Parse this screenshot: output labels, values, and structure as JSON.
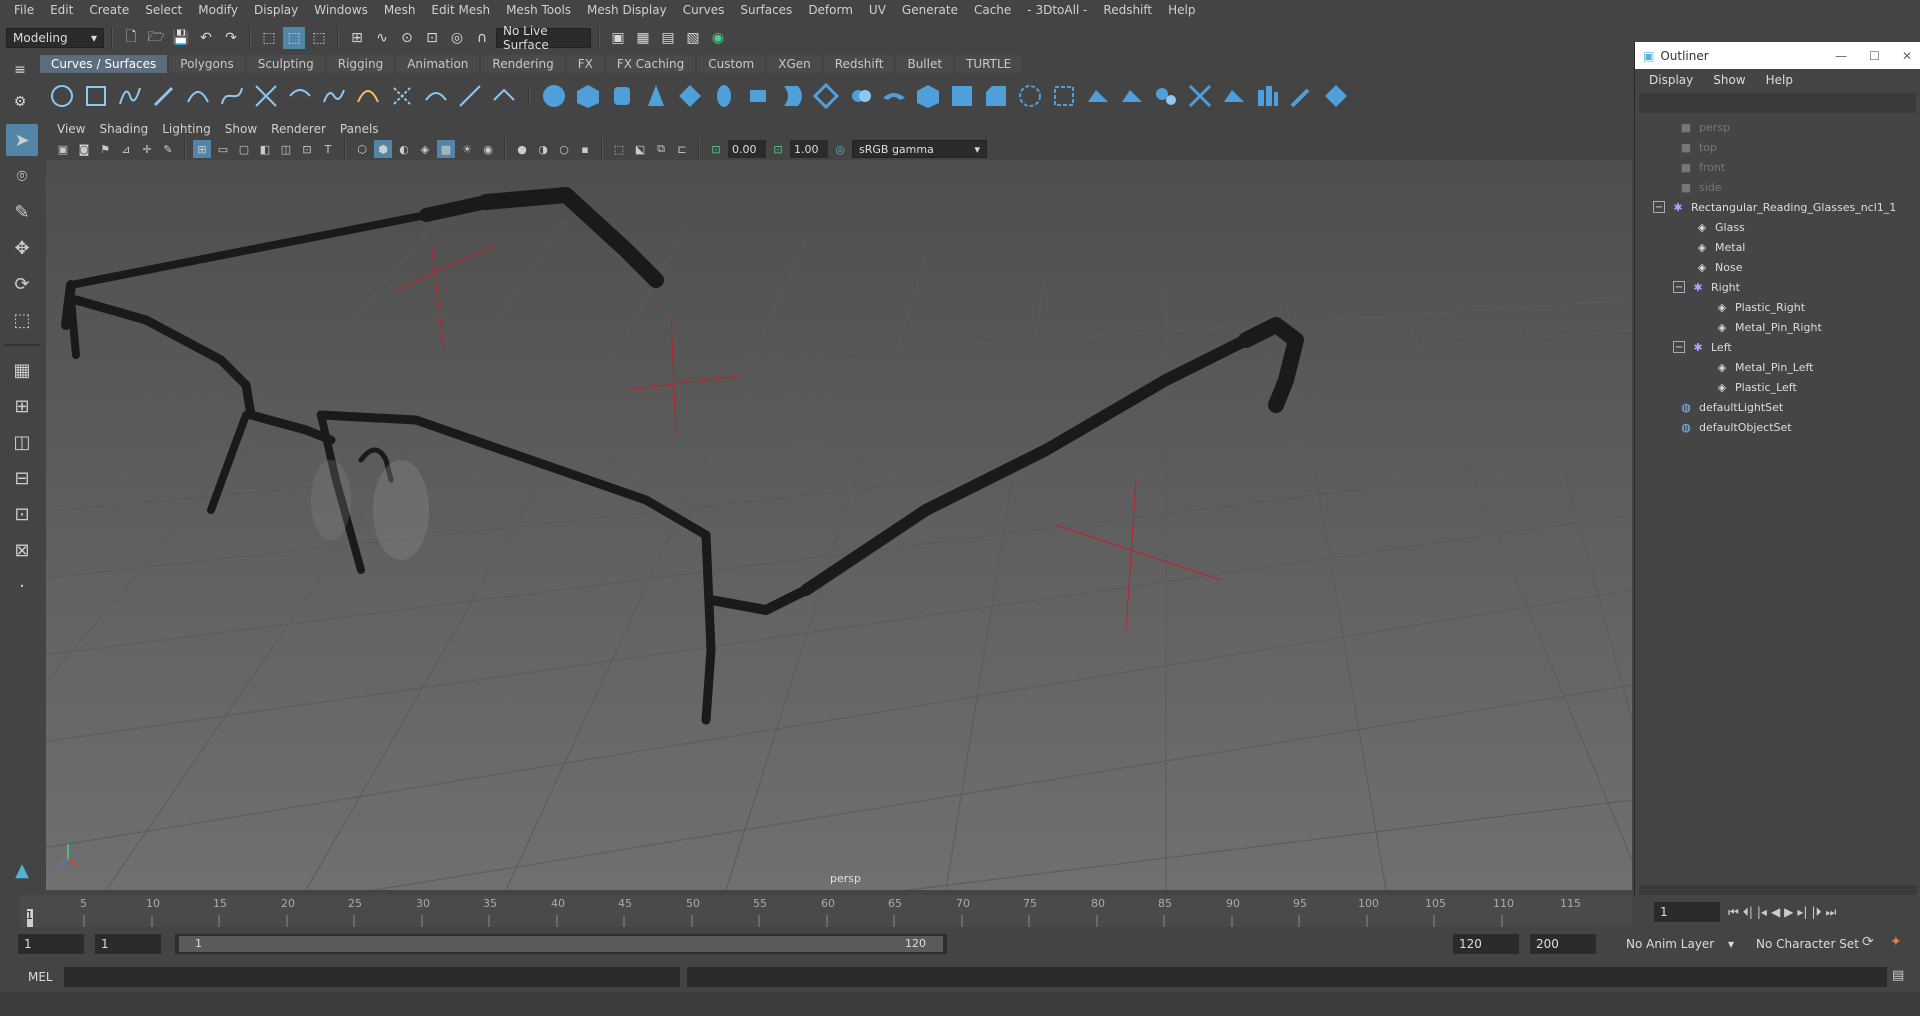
{
  "menubar": [
    "File",
    "Edit",
    "Create",
    "Select",
    "Modify",
    "Display",
    "Windows",
    "Mesh",
    "Edit Mesh",
    "Mesh Tools",
    "Mesh Display",
    "Curves",
    "Surfaces",
    "Deform",
    "UV",
    "Generate",
    "Cache",
    "- 3DtoAll -",
    "Redshift",
    "Help"
  ],
  "status": {
    "workspace": "Modeling",
    "live_surface": "No Live Surface"
  },
  "shelf_tabs": [
    "Curves / Surfaces",
    "Polygons",
    "Sculpting",
    "Rigging",
    "Animation",
    "Rendering",
    "FX",
    "FX Caching",
    "Custom",
    "XGen",
    "Redshift",
    "Bullet",
    "TURTLE"
  ],
  "viewport_menu": [
    "View",
    "Shading",
    "Lighting",
    "Show",
    "Renderer",
    "Panels"
  ],
  "viewport_toolbar": {
    "value_a": "0.00",
    "value_b": "1.00",
    "color_space": "sRGB gamma"
  },
  "viewport": {
    "camera_label": "persp"
  },
  "outliner": {
    "title": "Outliner",
    "menu": [
      "Display",
      "Show",
      "Help"
    ],
    "items": [
      {
        "label": "persp",
        "icon": "camera-icon",
        "dim": true
      },
      {
        "label": "top",
        "icon": "camera-icon",
        "dim": true
      },
      {
        "label": "front",
        "icon": "camera-icon",
        "dim": true
      },
      {
        "label": "side",
        "icon": "camera-icon",
        "dim": true
      },
      {
        "label": "Rectangular_Reading_Glasses_ncl1_1",
        "icon": "group-icon",
        "expander": "−"
      },
      {
        "label": "Glass",
        "icon": "mesh-icon"
      },
      {
        "label": "Metal",
        "icon": "mesh-icon"
      },
      {
        "label": "Nose",
        "icon": "mesh-icon"
      },
      {
        "label": "Right",
        "icon": "group-icon",
        "expander": "−"
      },
      {
        "label": "Plastic_Right",
        "icon": "mesh-icon"
      },
      {
        "label": "Metal_Pin_Right",
        "icon": "mesh-icon"
      },
      {
        "label": "Left",
        "icon": "group-icon",
        "expander": "−"
      },
      {
        "label": "Metal_Pin_Left",
        "icon": "mesh-icon"
      },
      {
        "label": "Plastic_Left",
        "icon": "mesh-icon"
      },
      {
        "label": "defaultLightSet",
        "icon": "set-icon"
      },
      {
        "label": "defaultObjectSet",
        "icon": "set-icon"
      }
    ]
  },
  "timeline": {
    "ticks": [
      "5",
      "10",
      "15",
      "20",
      "25",
      "30",
      "35",
      "40",
      "45",
      "50",
      "55",
      "60",
      "65",
      "70",
      "75",
      "80",
      "85",
      "90",
      "95",
      "100",
      "105",
      "110",
      "115"
    ],
    "current_frame": "1",
    "frame_start_mark": "1"
  },
  "range": {
    "start": "1",
    "inner_start": "1",
    "slider_start": "1",
    "slider_end": "120",
    "end": "120",
    "max_end": "200",
    "anim_layer": "No Anim Layer",
    "character_set": "No Character Set"
  },
  "cmdline": {
    "label": "MEL"
  }
}
